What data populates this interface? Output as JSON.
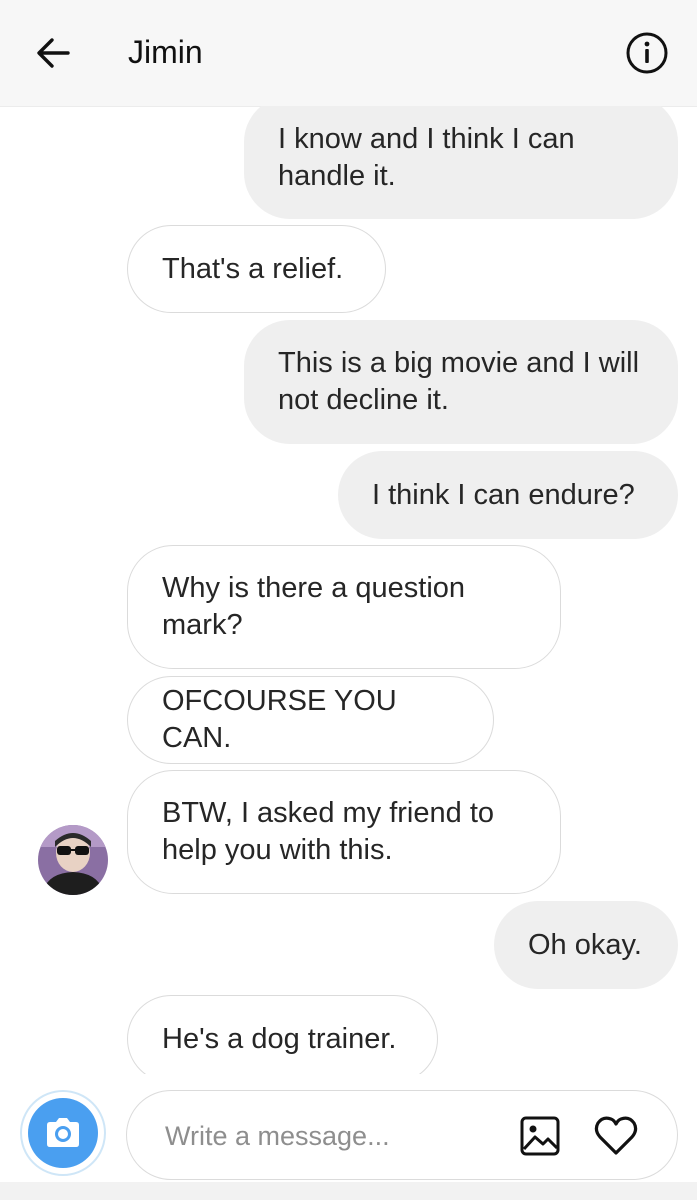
{
  "header": {
    "title": "Jimin"
  },
  "icons": {
    "back": "arrow-left",
    "info": "info-circle",
    "camera": "camera",
    "gallery": "image",
    "like": "heart"
  },
  "colors": {
    "sent_bubble": "#efefef",
    "received_border": "#dbdbdb",
    "camera_accent": "#4a9ff0"
  },
  "messages": [
    {
      "from": "me",
      "text": "I know and I think I can handle it."
    },
    {
      "from": "them",
      "text": "That's a relief."
    },
    {
      "from": "me",
      "text": "This is a big movie and I will not decline it."
    },
    {
      "from": "me",
      "text": "I think I can endure?"
    },
    {
      "from": "them",
      "text": "Why is there a question mark?"
    },
    {
      "from": "them",
      "text": "OFCOURSE YOU CAN."
    },
    {
      "from": "them",
      "text": "BTW, I asked my friend to help you with this."
    },
    {
      "from": "me",
      "text": "Oh okay."
    },
    {
      "from": "them",
      "text": "He's a dog trainer."
    }
  ],
  "composer": {
    "placeholder": "Write a message..."
  }
}
